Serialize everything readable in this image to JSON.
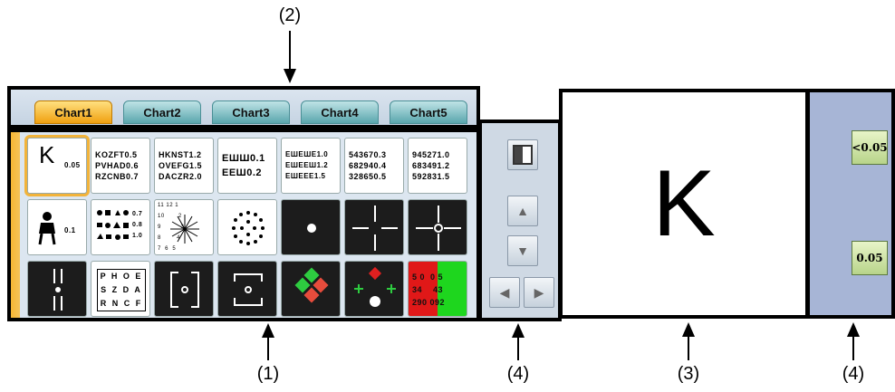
{
  "callouts": {
    "tabs": "(2)",
    "grid": "(1)",
    "nav": "(4)",
    "preview": "(3)",
    "acuity": "(4)"
  },
  "tabs": [
    {
      "label": "Chart1",
      "active": true
    },
    {
      "label": "Chart2",
      "active": false
    },
    {
      "label": "Chart3",
      "active": false
    },
    {
      "label": "Chart4",
      "active": false
    },
    {
      "label": "Chart5",
      "active": false
    }
  ],
  "grid": {
    "row1": {
      "c1": {
        "letter": "K",
        "value": "0.05"
      },
      "c2": {
        "lines": "KOZFT0.5\nPVHAD0.6\nRZCNB0.7"
      },
      "c3": {
        "lines": "HKNST1.2\nOVEFG1.5\nDACZR2.0"
      },
      "c4": {
        "lines": "ЕШШ0.1\nЕЕШ0.2"
      },
      "c5": {
        "lines": "ЕШЕШЕ1.0\nЕШЕЕШ1.2\nЕШЕЕЕ1.5"
      },
      "c6": {
        "lines": "543670.3\n682940.4\n328650.5"
      },
      "c7": {
        "lines": "945271.0\n683491.2\n592831.5"
      }
    },
    "row2": {
      "c1": {
        "value": "0.1"
      },
      "c2": {
        "lines": "0.7\n0.8\n1.0"
      },
      "c3": {
        "numbers": "11 12 1\n10       2\n9          3\n8        4\n7  6  5"
      }
    },
    "row3": {
      "c2": {
        "lines": "P H O E\nS Z D A\nR N C F"
      },
      "c7": {
        "lines": "5 0  0 5\n34    43\n290 092"
      }
    }
  },
  "preview": {
    "letter": "K"
  },
  "acuity": {
    "btn1": "<0.05",
    "btn2": "0.05"
  }
}
